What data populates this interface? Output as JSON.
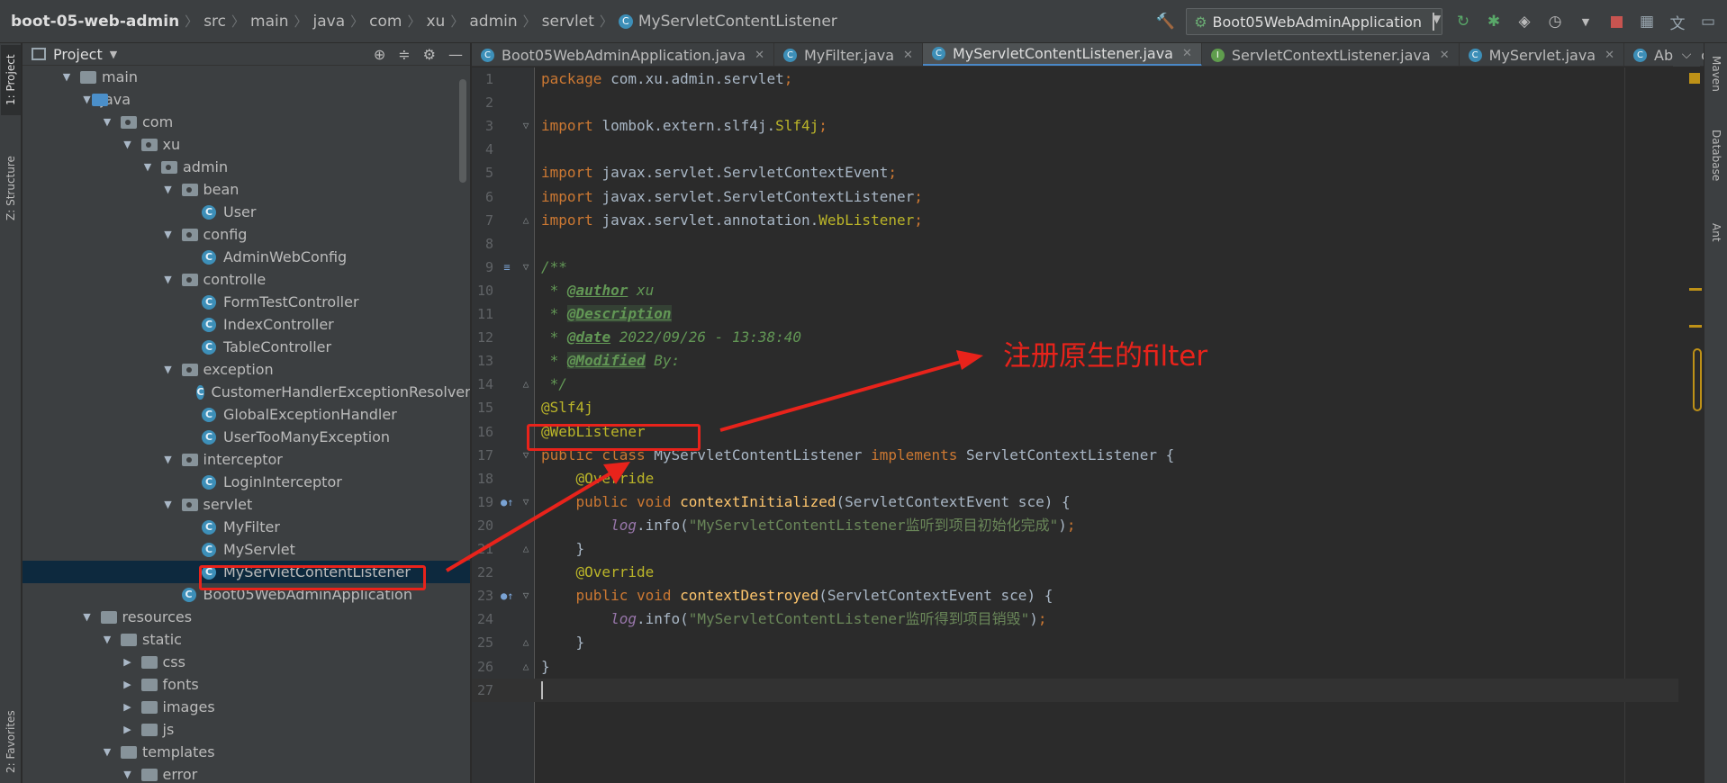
{
  "breadcrumb": [
    "boot-05-web-admin",
    "src",
    "main",
    "java",
    "com",
    "xu",
    "admin",
    "servlet",
    "MyServletContentListener"
  ],
  "run_config": "Boot05WebAdminApplication",
  "left_tabs": [
    "1: Project",
    "Z: Structure",
    "2: Favorites"
  ],
  "right_tabs": [
    "Maven",
    "Database",
    "Ant"
  ],
  "project": {
    "title": "Project",
    "tree": [
      {
        "label": "main",
        "depth": 0,
        "kind": "folder",
        "expanded": true
      },
      {
        "label": "java",
        "depth": 1,
        "kind": "src",
        "expanded": true
      },
      {
        "label": "com",
        "depth": 2,
        "kind": "pkg",
        "expanded": true
      },
      {
        "label": "xu",
        "depth": 3,
        "kind": "pkg",
        "expanded": true
      },
      {
        "label": "admin",
        "depth": 4,
        "kind": "pkg",
        "expanded": true
      },
      {
        "label": "bean",
        "depth": 5,
        "kind": "pkg",
        "expanded": true
      },
      {
        "label": "User",
        "depth": 6,
        "kind": "class"
      },
      {
        "label": "config",
        "depth": 5,
        "kind": "pkg",
        "expanded": true
      },
      {
        "label": "AdminWebConfig",
        "depth": 6,
        "kind": "class"
      },
      {
        "label": "controlle",
        "depth": 5,
        "kind": "pkg",
        "expanded": true
      },
      {
        "label": "FormTestController",
        "depth": 6,
        "kind": "class"
      },
      {
        "label": "IndexController",
        "depth": 6,
        "kind": "class"
      },
      {
        "label": "TableController",
        "depth": 6,
        "kind": "class"
      },
      {
        "label": "exception",
        "depth": 5,
        "kind": "pkg",
        "expanded": true
      },
      {
        "label": "CustomerHandlerExceptionResolver",
        "depth": 6,
        "kind": "class"
      },
      {
        "label": "GlobalExceptionHandler",
        "depth": 6,
        "kind": "class"
      },
      {
        "label": "UserTooManyException",
        "depth": 6,
        "kind": "class"
      },
      {
        "label": "interceptor",
        "depth": 5,
        "kind": "pkg",
        "expanded": true
      },
      {
        "label": "LoginInterceptor",
        "depth": 6,
        "kind": "class"
      },
      {
        "label": "servlet",
        "depth": 5,
        "kind": "pkg",
        "expanded": true
      },
      {
        "label": "MyFilter",
        "depth": 6,
        "kind": "class"
      },
      {
        "label": "MyServlet",
        "depth": 6,
        "kind": "class"
      },
      {
        "label": "MyServletContentListener",
        "depth": 6,
        "kind": "class",
        "selected": true
      },
      {
        "label": "Boot05WebAdminApplication",
        "depth": 5,
        "kind": "class"
      },
      {
        "label": "resources",
        "depth": 1,
        "kind": "res",
        "expanded": true
      },
      {
        "label": "static",
        "depth": 2,
        "kind": "folder",
        "expanded": true
      },
      {
        "label": "css",
        "depth": 3,
        "kind": "folder",
        "expanded": false
      },
      {
        "label": "fonts",
        "depth": 3,
        "kind": "folder",
        "expanded": false
      },
      {
        "label": "images",
        "depth": 3,
        "kind": "folder",
        "expanded": false
      },
      {
        "label": "js",
        "depth": 3,
        "kind": "folder",
        "expanded": false
      },
      {
        "label": "templates",
        "depth": 2,
        "kind": "folder",
        "expanded": true
      },
      {
        "label": "error",
        "depth": 3,
        "kind": "folder",
        "expanded": true
      }
    ]
  },
  "tabs": [
    {
      "label": "Boot05WebAdminApplication.java",
      "icon": "C",
      "active": false,
      "close": true
    },
    {
      "label": "MyFilter.java",
      "icon": "C",
      "active": false,
      "close": true
    },
    {
      "label": "MyServletContentListener.java",
      "icon": "C",
      "active": true,
      "close": true
    },
    {
      "label": "ServletContextListener.java",
      "icon": "I",
      "active": false,
      "close": true
    },
    {
      "label": "MyServlet.java",
      "icon": "C",
      "active": false,
      "close": true
    },
    {
      "label": "AbstractHandle",
      "icon": "C",
      "active": false,
      "close": false
    }
  ],
  "code": [
    [
      [
        "kw",
        "package "
      ],
      [
        "t",
        "com.xu.admin.servlet"
      ],
      [
        "kw",
        ";"
      ]
    ],
    [],
    [
      [
        "kw",
        "import "
      ],
      [
        "t",
        "lombok.extern.slf4j."
      ],
      [
        "ann",
        "Slf4j"
      ],
      [
        "kw",
        ";"
      ]
    ],
    [],
    [
      [
        "kw",
        "import "
      ],
      [
        "t",
        "javax.servlet.ServletContextEvent"
      ],
      [
        "kw",
        ";"
      ]
    ],
    [
      [
        "kw",
        "import "
      ],
      [
        "t",
        "javax.servlet.ServletContextListener"
      ],
      [
        "kw",
        ";"
      ]
    ],
    [
      [
        "kw",
        "import "
      ],
      [
        "t",
        "javax.servlet.annotation."
      ],
      [
        "ann",
        "WebListener"
      ],
      [
        "kw",
        ";"
      ]
    ],
    [],
    [
      [
        "cm",
        "/**"
      ]
    ],
    [
      [
        "cm",
        " * "
      ],
      [
        "cmtag",
        "@author"
      ],
      [
        "cm",
        " xu"
      ]
    ],
    [
      [
        "cm",
        " * "
      ],
      [
        "cmtagh",
        "@Description"
      ]
    ],
    [
      [
        "cm",
        " * "
      ],
      [
        "cmtag",
        "@date"
      ],
      [
        "cm",
        " 2022/09/26 - 13:38:40"
      ]
    ],
    [
      [
        "cm",
        " * "
      ],
      [
        "cmtagh",
        "@Modified"
      ],
      [
        "cm",
        " By:"
      ]
    ],
    [
      [
        "cm",
        " */"
      ]
    ],
    [
      [
        "ann",
        "@Slf4j"
      ]
    ],
    [
      [
        "ann",
        "@WebListener"
      ]
    ],
    [
      [
        "kw",
        "public class "
      ],
      [
        "t",
        "MyServletContentListener "
      ],
      [
        "kw",
        "implements "
      ],
      [
        "t",
        "ServletContextListener {"
      ]
    ],
    [
      [
        "t",
        "    "
      ],
      [
        "ann",
        "@Override"
      ]
    ],
    [
      [
        "t",
        "    "
      ],
      [
        "kw",
        "public void "
      ],
      [
        "fn",
        "contextInitialized"
      ],
      [
        "t",
        "(ServletContextEvent sce) {"
      ]
    ],
    [
      [
        "t",
        "        "
      ],
      [
        "fld",
        "log"
      ],
      [
        "t",
        ".info("
      ],
      [
        "str",
        "\"MyServletContentListener监听到项目初始化完成\""
      ],
      [
        "t",
        ")"
      ],
      [
        "kw",
        ";"
      ]
    ],
    [
      [
        "t",
        "    }"
      ]
    ],
    [
      [
        "t",
        "    "
      ],
      [
        "ann",
        "@Override"
      ]
    ],
    [
      [
        "t",
        "    "
      ],
      [
        "kw",
        "public void "
      ],
      [
        "fn",
        "contextDestroyed"
      ],
      [
        "t",
        "(ServletContextEvent sce) {"
      ]
    ],
    [
      [
        "t",
        "        "
      ],
      [
        "fld",
        "log"
      ],
      [
        "t",
        ".info("
      ],
      [
        "str",
        "\"MyServletContentListener监听得到项目销毁\""
      ],
      [
        "t",
        ")"
      ],
      [
        "kw",
        ";"
      ]
    ],
    [
      [
        "t",
        "    }"
      ]
    ],
    [
      [
        "t",
        "}"
      ]
    ],
    []
  ],
  "annotation_text": "注册原生的filter",
  "colors": {
    "annotation": "#e8231b",
    "keyword": "#cc7832",
    "annotation_code": "#bbb529",
    "string": "#6a8759",
    "comment": "#629755"
  }
}
